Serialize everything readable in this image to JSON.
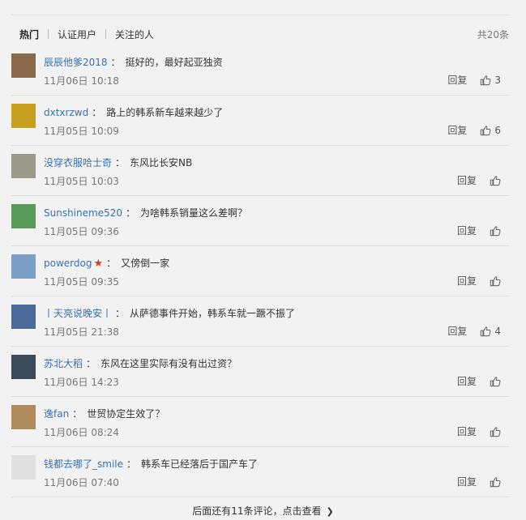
{
  "tabs": [
    {
      "label": "热门",
      "active": true
    },
    {
      "label": "认证用户",
      "active": false
    },
    {
      "label": "关注的人",
      "active": false
    }
  ],
  "total_label": "共20条",
  "comments": [
    {
      "user": "辰辰他爹2018",
      "text": "挺好的，最好起亚独资",
      "time": "11月06日 10:18",
      "reply": "回复",
      "likes": "3",
      "avatar_color": "#8a6a4a"
    },
    {
      "user": "dxtxrzwd",
      "text": "路上的韩系新车越来越少了",
      "time": "11月05日 10:09",
      "reply": "回复",
      "likes": "6",
      "avatar_color": "#c8a020"
    },
    {
      "user": "没穿衣服哈士奇",
      "text": "东风比长安NB",
      "time": "11月05日 10:03",
      "reply": "回复",
      "likes": "",
      "avatar_color": "#9a9a8a"
    },
    {
      "user": "Sunshineme520",
      "text": "为啥韩系销量这么差啊？",
      "time": "11月05日 09:36",
      "reply": "回复",
      "likes": "",
      "avatar_color": "#5a9a5a"
    },
    {
      "user": "powerdog",
      "text": "又傍倒一家",
      "time": "11月05日 09:35",
      "reply": "回复",
      "likes": "",
      "avatar_color": "#7aa0c8",
      "badge": "★"
    },
    {
      "user": "丨天亮说晚安丨",
      "text": "从萨德事件开始，韩系车就一蹶不振了",
      "time": "11月05日 21:38",
      "reply": "回复",
      "likes": "4",
      "avatar_color": "#4a6a9a"
    },
    {
      "user": "苏北大稻",
      "text": "东风在这里实际有没有出过资？",
      "time": "11月06日 14:23",
      "reply": "回复",
      "likes": "",
      "avatar_color": "#3a4a5a"
    },
    {
      "user": "逸fan",
      "text": "世贸协定生效了？",
      "time": "11月06日 08:24",
      "reply": "回复",
      "likes": "",
      "avatar_color": "#b08a5a"
    },
    {
      "user": "钱都去哪了_smile",
      "text": "韩系车已经落后于国产车了",
      "time": "11月06日 07:40",
      "reply": "回复",
      "likes": "",
      "avatar_color": "#e0e0e0"
    }
  ],
  "more_label": "后面还有11条评论，点击查看"
}
